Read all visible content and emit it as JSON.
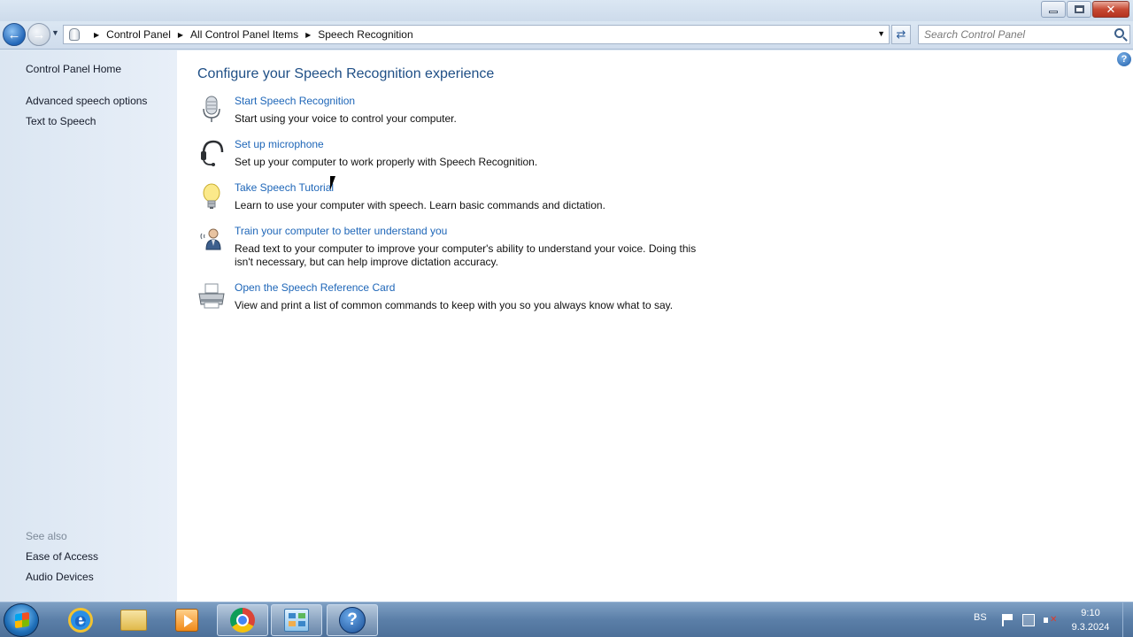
{
  "window": {
    "title_buttons": {
      "minimize": "minimize-icon",
      "maximize": "maximize-icon",
      "close": "close-icon"
    }
  },
  "navigation": {
    "breadcrumb": [
      "Control Panel",
      "All Control Panel Items",
      "Speech Recognition"
    ],
    "search": {
      "placeholder": "Search Control Panel",
      "value": ""
    }
  },
  "sidebar": {
    "home": "Control Panel Home",
    "links": [
      "Advanced speech options",
      "Text to Speech"
    ],
    "see_also_label": "See also",
    "see_also": [
      "Ease of Access",
      "Audio Devices"
    ]
  },
  "main": {
    "title": "Configure your Speech Recognition experience",
    "tasks": [
      {
        "icon": "microphone-icon",
        "link": "Start Speech Recognition",
        "description": "Start using your voice to control your computer."
      },
      {
        "icon": "headset-icon",
        "link": "Set up microphone",
        "description": "Set up your computer to work properly with Speech Recognition."
      },
      {
        "icon": "lightbulb-icon",
        "link": "Take Speech Tutorial",
        "description": "Learn to use your computer with speech.  Learn basic commands and dictation."
      },
      {
        "icon": "user-voice-icon",
        "link": "Train your computer to better understand you",
        "description": "Read text to your computer to improve your computer's ability to understand your voice.  Doing this isn't necessary, but can help improve dictation accuracy."
      },
      {
        "icon": "printer-icon",
        "link": "Open the Speech Reference Card",
        "description": "View and print a list of common commands to keep with you so you always know what to say."
      }
    ]
  },
  "taskbar": {
    "apps": [
      "internet-explorer-icon",
      "folder-icon",
      "media-player-icon",
      "chrome-icon",
      "control-panel-icon",
      "help-icon"
    ],
    "language": "BS",
    "time": "9:10",
    "date": "9.3.2024"
  }
}
